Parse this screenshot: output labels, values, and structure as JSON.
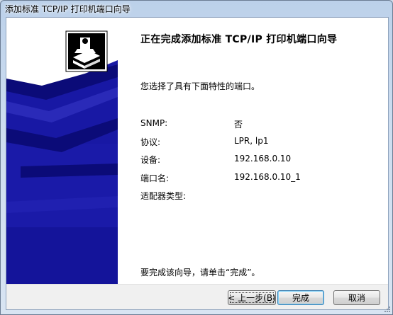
{
  "window": {
    "title": "添加标准 TCP/IP 打印机端口向导"
  },
  "banner": {
    "icon": "printer-icon"
  },
  "main": {
    "heading": "正在完成添加标准 TCP/IP 打印机端口向导",
    "intro": "您选择了具有下面特性的端口。",
    "properties": [
      {
        "label": "SNMP:",
        "value": "否"
      },
      {
        "label": "协议:",
        "value": "LPR, lp1"
      },
      {
        "label": "设备:",
        "value": "192.168.0.10"
      },
      {
        "label": "端口名:",
        "value": "192.168.0.10_1"
      },
      {
        "label": "适配器类型:",
        "value": ""
      }
    ],
    "finish_hint": "要完成该向导，请单击“完成”。"
  },
  "buttons": {
    "back": "< 上一步(B)",
    "finish": "完成",
    "cancel": "取消"
  },
  "colors": {
    "banner_blue": "#1a1aa8",
    "banner_dark": "#0b0b78",
    "titlebar": "#bcd1ea"
  }
}
